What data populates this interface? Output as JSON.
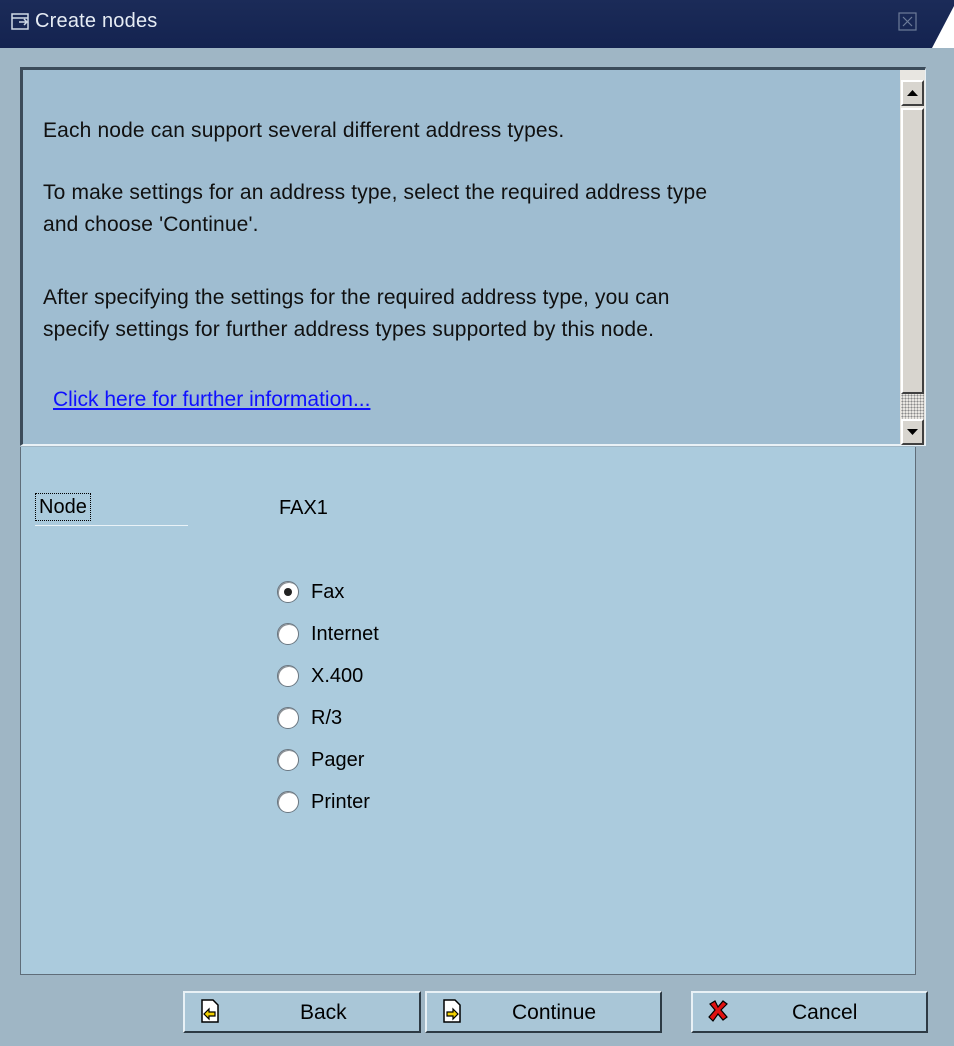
{
  "window": {
    "title": "Create nodes"
  },
  "info": {
    "line1": "Each node can support several different address types.",
    "line2": "To make settings for an address type, select the required address type",
    "line3": "and choose 'Continue'.",
    "line4": "After specifying the settings for the required address type, you can",
    "line5": "specify settings for further address types supported by this node.",
    "link": "Click here for further information..."
  },
  "form": {
    "node_label": "Node",
    "node_value": "FAX1",
    "address_types": [
      {
        "label": "Fax",
        "selected": true
      },
      {
        "label": "Internet",
        "selected": false
      },
      {
        "label": "X.400",
        "selected": false
      },
      {
        "label": "R/3",
        "selected": false
      },
      {
        "label": "Pager",
        "selected": false
      },
      {
        "label": "Printer",
        "selected": false
      }
    ]
  },
  "buttons": {
    "back": "Back",
    "continue": "Continue",
    "cancel": "Cancel"
  },
  "colors": {
    "titlebar": "#1b2b58",
    "background": "#9fb6c5",
    "panel": "#abcbdd",
    "link": "#1010ff",
    "cancel_icon": "#e01010"
  }
}
